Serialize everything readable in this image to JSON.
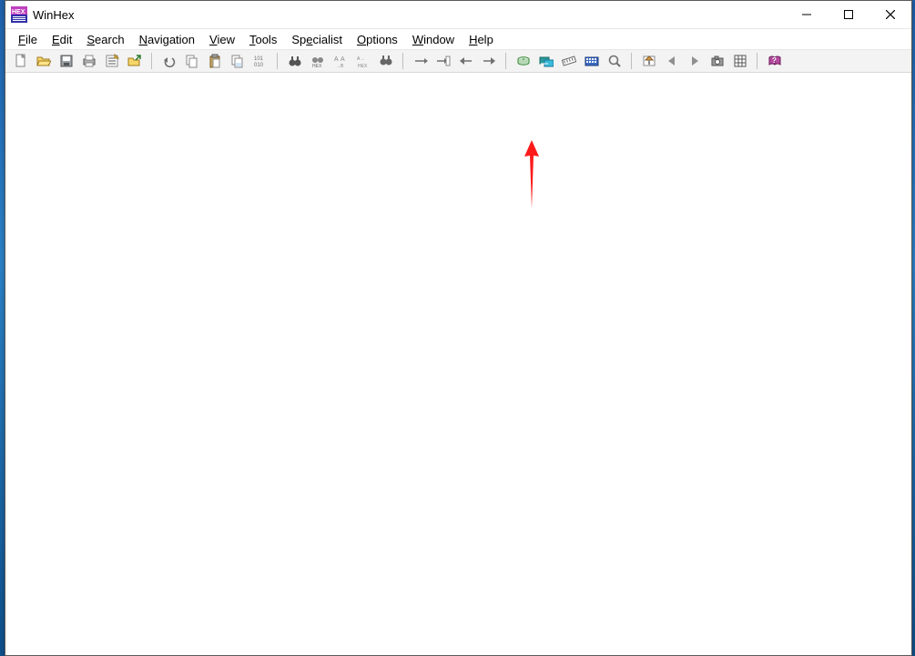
{
  "window": {
    "title": "WinHex"
  },
  "menu": {
    "file": "File",
    "edit": "Edit",
    "search": "Search",
    "navigation": "Navigation",
    "view": "View",
    "tools": "Tools",
    "specialist": "Specialist",
    "options": "Options",
    "window": "Window",
    "help": "Help"
  },
  "toolbar": {
    "new": "New",
    "open": "Open",
    "save": "Save",
    "print": "Print",
    "properties": "Properties",
    "create_backup": "Create Backup",
    "undo": "Undo",
    "copy": "Copy Block",
    "paste": "Paste Clipboard",
    "copy_sector": "Copy Sector",
    "bin_block": "Write Block",
    "find_text": "Find Text",
    "find_hex": "Find Hex",
    "replace_text": "Replace Text",
    "replace_hex": "Replace Hex",
    "find_again": "Find Again",
    "goto_offset": "Go To Offset",
    "goto_sector": "Go To Sector",
    "back": "Back",
    "forward": "Forward",
    "open_disk": "Open Disk",
    "open_ram": "Open RAM",
    "disk_tools": "Disk Tools",
    "calculator": "Calculator",
    "analyze": "Analyze",
    "position_manager": "Position Manager",
    "pos_back": "Position Back",
    "pos_fwd": "Position Forward",
    "snapshot": "Snapshot",
    "calc2": "Data Interpreter",
    "help": "Help"
  }
}
